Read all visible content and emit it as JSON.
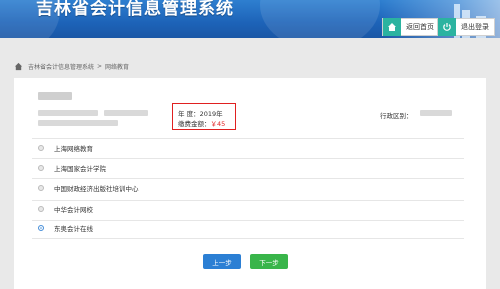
{
  "header": {
    "title": "吉林省会计信息管理系统",
    "home_label": "返回首页",
    "logout_label": "退出登录"
  },
  "breadcrumb": {
    "root": "吉林省会计信息管理系统",
    "separator": ">",
    "current": "网络教育"
  },
  "info": {
    "year_label": "年       度：",
    "year_value": "2019年",
    "fee_label": "缴费金额：",
    "fee_value": "￥45",
    "region_label": "行政区别："
  },
  "options": [
    {
      "label": "上海网络教育",
      "checked": false
    },
    {
      "label": "上海国家会计学院",
      "checked": false
    },
    {
      "label": "中国财政经济出版社培训中心",
      "checked": false
    },
    {
      "label": "中华会计网校",
      "checked": false
    },
    {
      "label": "东奥会计在线",
      "checked": true
    }
  ],
  "buttons": {
    "prev_label": "上一步",
    "next_label": "下一步"
  },
  "colors": {
    "banner": "#1d63b8",
    "highlight_border": "#e02020",
    "prev_button": "#2b7fd4",
    "next_button": "#39b54a",
    "icon_teal": "#2bb3a0"
  }
}
